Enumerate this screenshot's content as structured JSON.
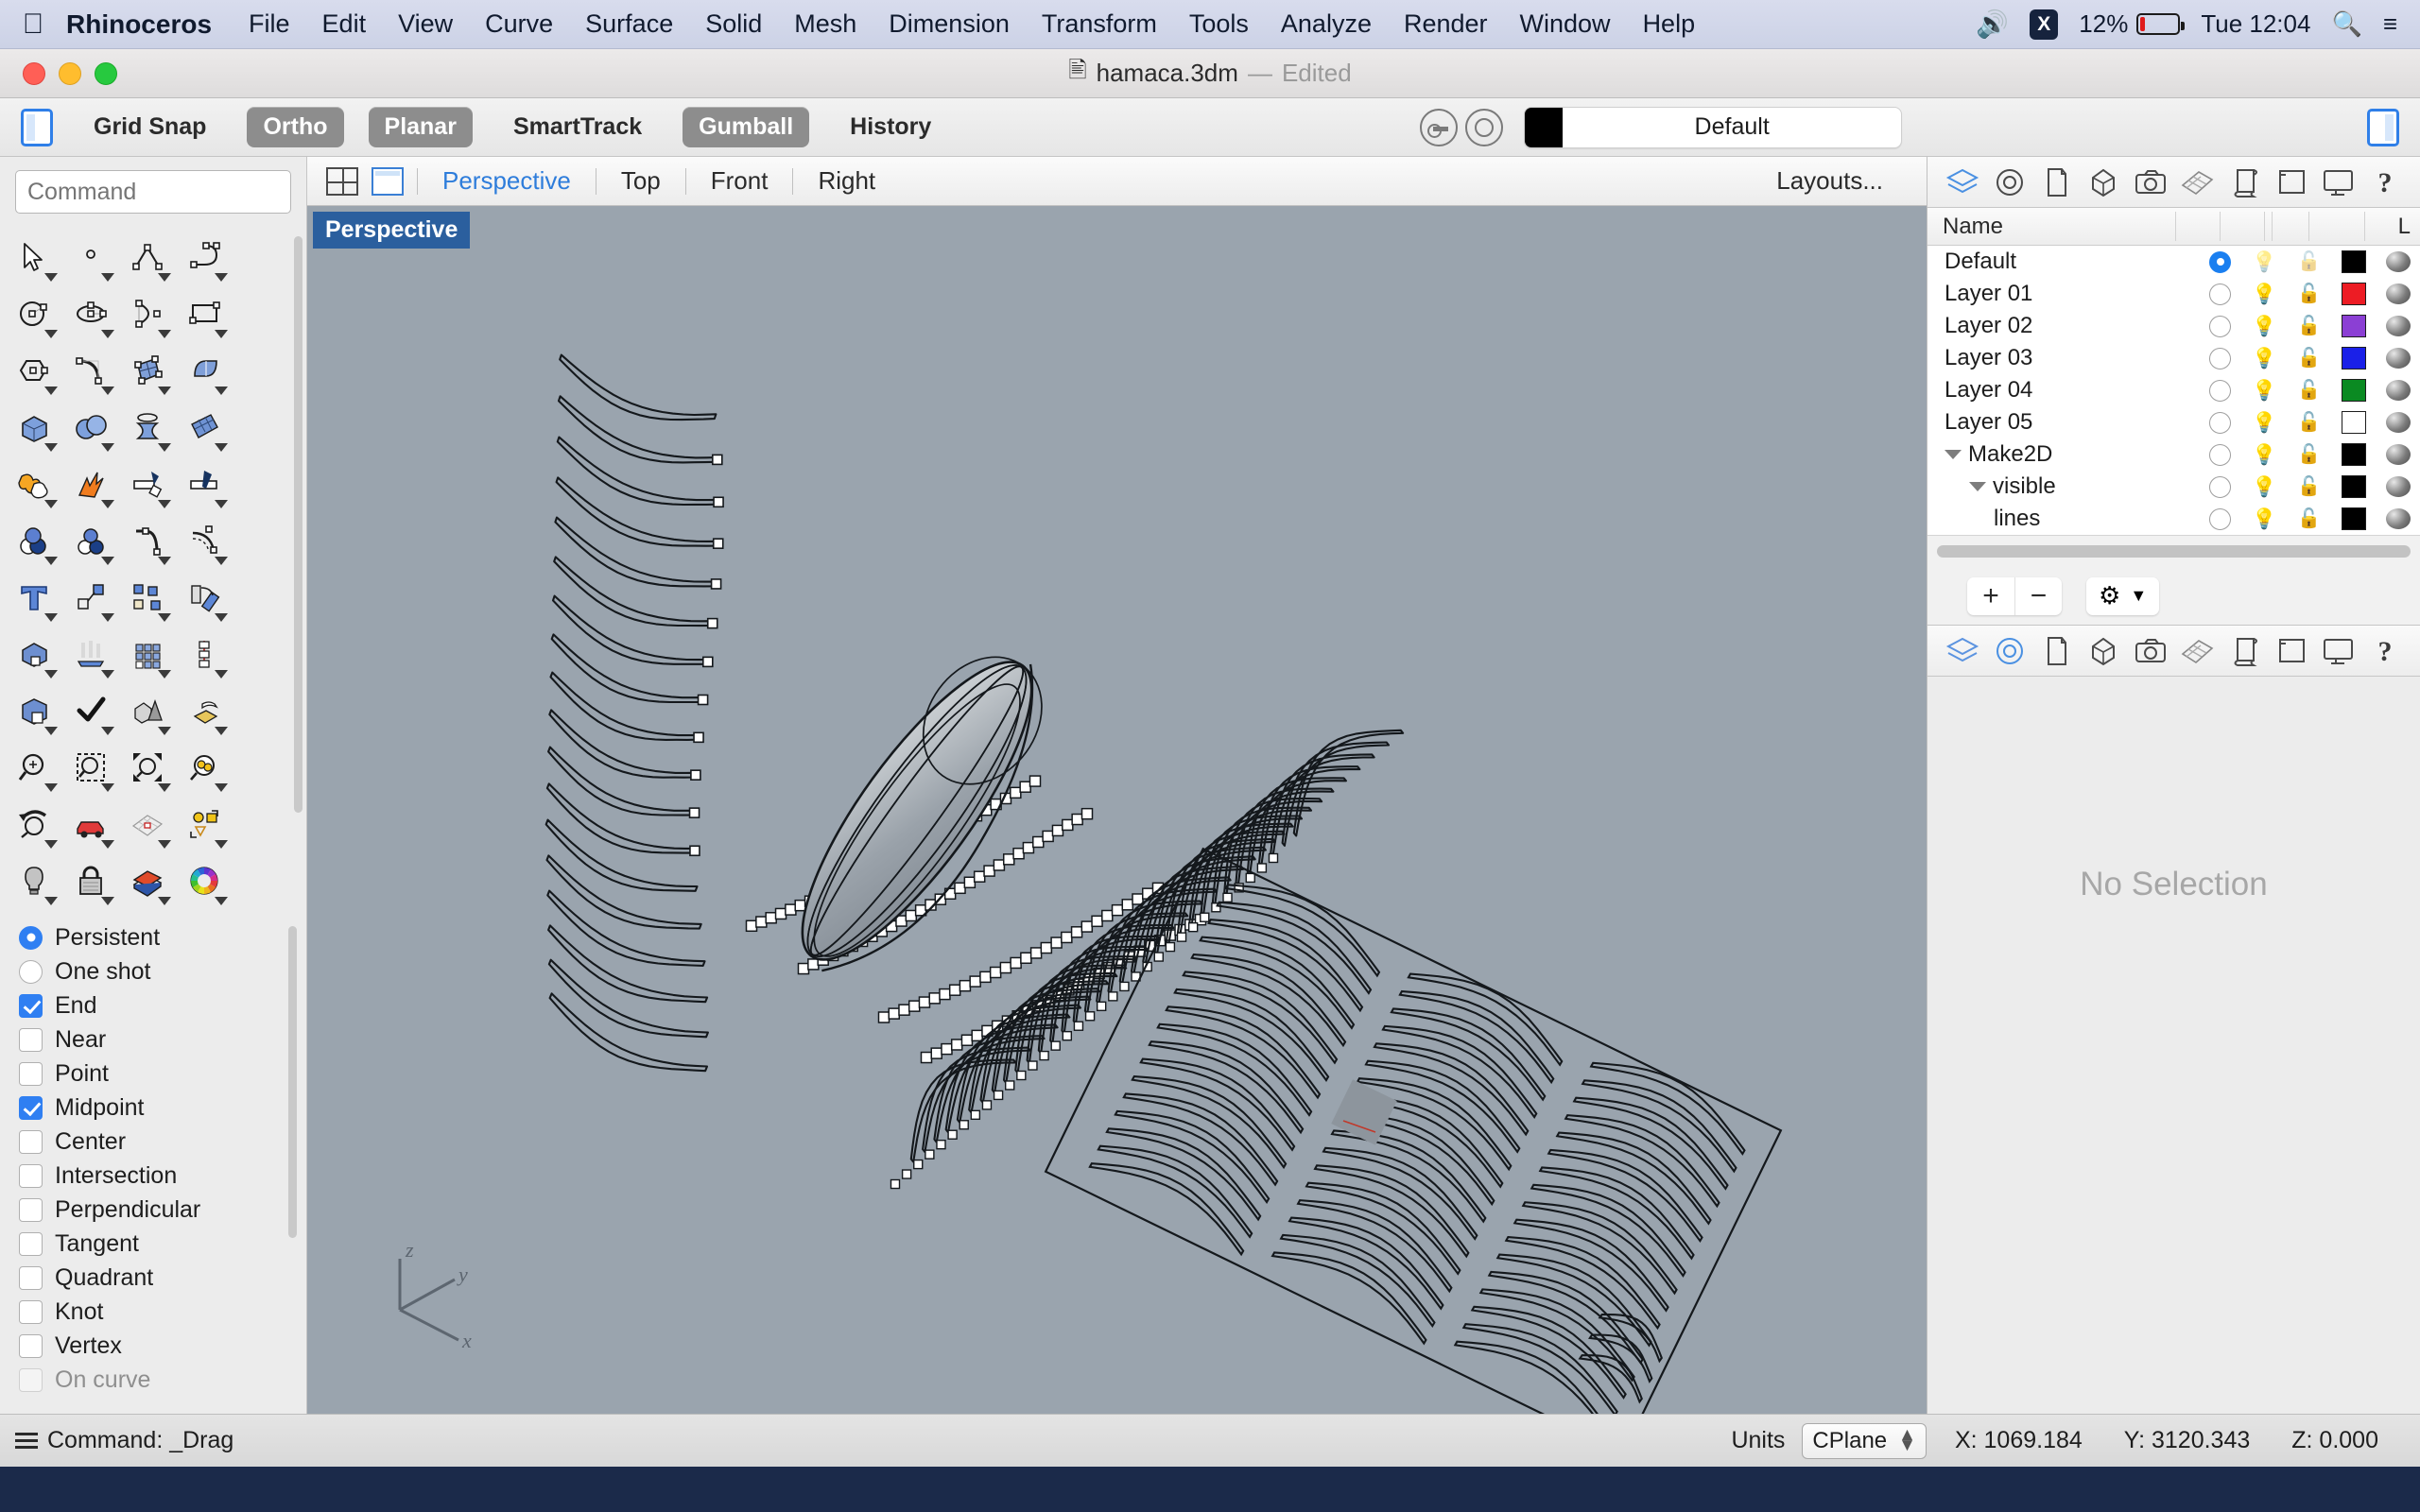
{
  "menubar": {
    "apple_icon": "apple-icon",
    "app_name": "Rhinoceros",
    "items": [
      "File",
      "Edit",
      "View",
      "Curve",
      "Surface",
      "Solid",
      "Mesh",
      "Dimension",
      "Transform",
      "Tools",
      "Analyze",
      "Render",
      "Window",
      "Help"
    ],
    "volume_icon": "volume-icon",
    "app_badge": "X",
    "battery_percent": "12%",
    "battery_level": 12,
    "clock": "Tue 12:04",
    "search_icon": "search-icon",
    "list_icon": "control-center-icon"
  },
  "titlebar": {
    "document_icon": "rhino-document-icon",
    "filename": "hamaca.3dm",
    "dash": "—",
    "edited": "Edited"
  },
  "toolstrip": {
    "left_panel_toggle": "left-panel-icon",
    "right_panel_toggle": "right-panel-icon",
    "toggles": [
      {
        "label": "Grid Snap",
        "on": false
      },
      {
        "label": "Ortho",
        "on": true
      },
      {
        "label": "Planar",
        "on": true
      },
      {
        "label": "SmartTrack",
        "on": false
      },
      {
        "label": "Gumball",
        "on": true
      },
      {
        "label": "History",
        "on": false
      }
    ],
    "osnap_icon": "osnap-icon",
    "record_icon": "record-history-icon",
    "current_layer": "Default",
    "current_layer_color": "#000000"
  },
  "command": {
    "placeholder": "Command",
    "value": ""
  },
  "palette": {
    "rows": [
      [
        "select-arrow-icon",
        "point-icon",
        "polyline-icon",
        "curve-icon"
      ],
      [
        "circle-icon",
        "ellipse-icon",
        "arc-icon",
        "rectangle-icon"
      ],
      [
        "polygon-icon",
        "freeform-curve-icon",
        "surface-from-curves-icon",
        "extrude-surface-icon"
      ],
      [
        "box-icon",
        "sphere-boolean-icon",
        "revolve-icon",
        "mesh-icon"
      ],
      [
        "join-icon",
        "explode-icon",
        "trim-icon",
        "split-icon"
      ],
      [
        "boolean-union-icon",
        "boolean-difference-icon",
        "fillet-curve-icon",
        "offset-curve-icon"
      ],
      [
        "text-icon",
        "move-icon",
        "copy-icon",
        "rotate-icon"
      ],
      [
        "scale-icon",
        "mirror-icon",
        "array-icon",
        "array-polar-icon"
      ],
      [
        "shell-icon",
        "check-icon",
        "analyze-icon",
        "drape-icon"
      ],
      [
        "zoom-icon",
        "zoom-window-icon",
        "zoom-extents-icon",
        "zoom-selected-icon"
      ],
      [
        "zoom-previous-icon",
        "walkabout-icon",
        "cplane-icon",
        "named-view-icon"
      ],
      [
        "light-icon",
        "lock-icon",
        "render-icon",
        "color-wheel-icon"
      ]
    ]
  },
  "osnap": {
    "modes": [
      {
        "label": "Persistent",
        "type": "radio",
        "on": true
      },
      {
        "label": "One shot",
        "type": "radio",
        "on": false
      }
    ],
    "snaps": [
      {
        "label": "End",
        "on": true
      },
      {
        "label": "Near",
        "on": false
      },
      {
        "label": "Point",
        "on": false
      },
      {
        "label": "Midpoint",
        "on": true
      },
      {
        "label": "Center",
        "on": false
      },
      {
        "label": "Intersection",
        "on": false
      },
      {
        "label": "Perpendicular",
        "on": false
      },
      {
        "label": "Tangent",
        "on": false
      },
      {
        "label": "Quadrant",
        "on": false
      },
      {
        "label": "Knot",
        "on": false
      },
      {
        "label": "Vertex",
        "on": false
      },
      {
        "label": "On curve",
        "on": false
      }
    ]
  },
  "viewport_tabs": {
    "quad_icon": "four-view-icon",
    "single_icon": "single-view-icon",
    "tabs": [
      {
        "label": "Perspective",
        "active": true
      },
      {
        "label": "Top",
        "active": false
      },
      {
        "label": "Front",
        "active": false
      },
      {
        "label": "Right",
        "active": false
      }
    ],
    "layouts_label": "Layouts..."
  },
  "viewport": {
    "label": "Perspective",
    "background_color": "#9aa4ae",
    "axis_labels": {
      "x": "x",
      "y": "y",
      "z": "z"
    },
    "scene_description": "Exploded hammock slat study with curve array, control-point curves, ellipsoid surface and flat nesting sheet"
  },
  "right_panel": {
    "tabs": [
      "layers-icon",
      "properties-icon",
      "page-icon",
      "object-icon",
      "camera-icon",
      "materials-icon",
      "render-icon",
      "named-view-icon",
      "display-icon",
      "help-icon"
    ],
    "active_tab_index": 0,
    "header": {
      "name": "Name",
      "last_col": "L"
    },
    "layers": [
      {
        "name": "Default",
        "indent": 0,
        "current": true,
        "expander": "none",
        "color": "#000000",
        "visible": true,
        "locked": false
      },
      {
        "name": "Layer 01",
        "indent": 0,
        "current": false,
        "expander": "none",
        "color": "#ed1c24",
        "visible": true,
        "locked": false
      },
      {
        "name": "Layer 02",
        "indent": 0,
        "current": false,
        "expander": "none",
        "color": "#8b3fd4",
        "visible": true,
        "locked": false
      },
      {
        "name": "Layer 03",
        "indent": 0,
        "current": false,
        "expander": "none",
        "color": "#1a20e8",
        "visible": true,
        "locked": false
      },
      {
        "name": "Layer 04",
        "indent": 0,
        "current": false,
        "expander": "none",
        "color": "#0a8a22",
        "visible": true,
        "locked": false
      },
      {
        "name": "Layer 05",
        "indent": 0,
        "current": false,
        "expander": "none",
        "color": "#ffffff",
        "visible": true,
        "locked": false
      },
      {
        "name": "Make2D",
        "indent": 0,
        "current": false,
        "expander": "open",
        "color": "#000000",
        "visible": true,
        "locked": false
      },
      {
        "name": "visible",
        "indent": 1,
        "current": false,
        "expander": "open",
        "color": "#000000",
        "visible": true,
        "locked": false
      },
      {
        "name": "lines",
        "indent": 2,
        "current": false,
        "expander": "none",
        "color": "#000000",
        "visible": true,
        "locked": false
      }
    ],
    "tools": {
      "add": "+",
      "remove": "−",
      "gear": "gear-icon",
      "chevron": "chevron-down-icon"
    },
    "properties_tabs": [
      "layers-icon",
      "properties-icon",
      "page-icon",
      "object-icon",
      "camera-icon",
      "materials-icon",
      "render-icon",
      "named-view-icon",
      "display-icon",
      "help-icon"
    ],
    "properties_active_index": 1,
    "no_selection": "No Selection"
  },
  "statusbar": {
    "menu_icon": "hamburger-icon",
    "command_text": "Command: _Drag",
    "units_label": "Units",
    "cplane_value": "CPlane",
    "x": "X: 1069.184",
    "y": "Y: 3120.343",
    "z": "Z: 0.000"
  }
}
